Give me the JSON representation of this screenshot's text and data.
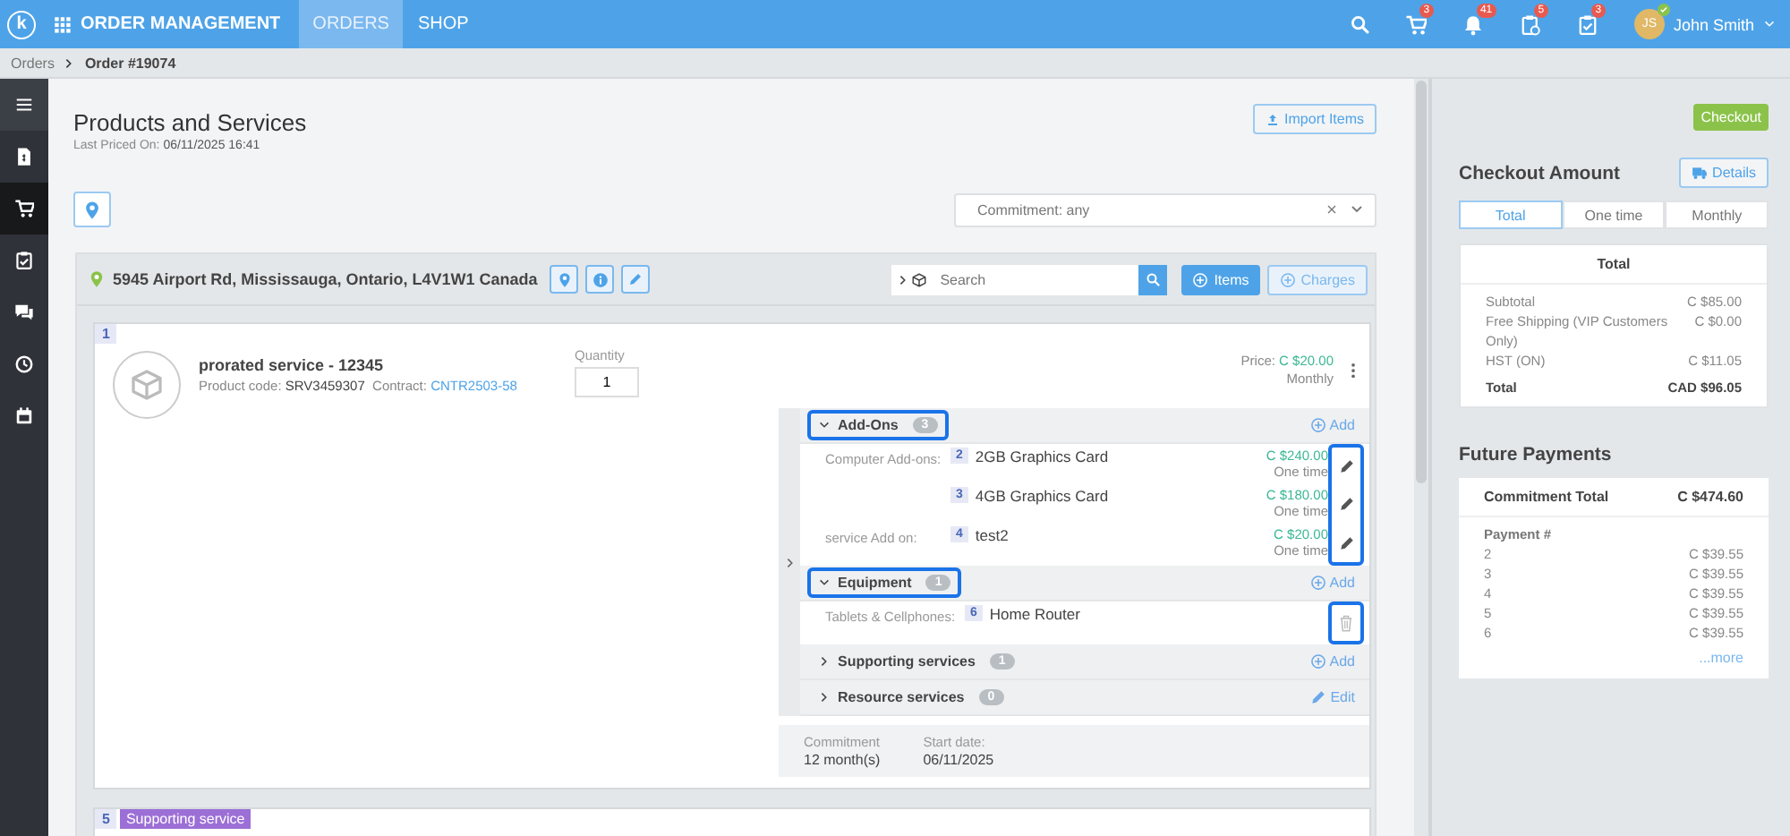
{
  "topbar": {
    "logo": "k",
    "app_title": "ORDER MANAGEMENT",
    "nav": [
      {
        "label": "ORDERS",
        "selected": true
      },
      {
        "label": "SHOP",
        "selected": false
      }
    ],
    "badges": [
      {
        "kind": "cart",
        "count": "3"
      },
      {
        "kind": "bell",
        "count": "41"
      },
      {
        "kind": "clipboard-clock",
        "count": "5"
      },
      {
        "kind": "clipboard-check",
        "count": "3"
      }
    ],
    "user": {
      "initials": "JS",
      "name": "John Smith",
      "online": true
    }
  },
  "breadcrumb": [
    "Orders",
    "Order #19074"
  ],
  "sidebar": {
    "items": [
      {
        "kind": "menu",
        "selected": false
      },
      {
        "kind": "invoice",
        "selected": false
      },
      {
        "kind": "cart",
        "selected": true
      },
      {
        "kind": "clipboard",
        "selected": false
      },
      {
        "kind": "chat",
        "selected": false
      },
      {
        "kind": "clock",
        "selected": false
      },
      {
        "kind": "calendar",
        "selected": false
      }
    ]
  },
  "page": {
    "title": "Products and Services",
    "last_priced_label": "Last Priced On:",
    "last_priced": "06/11/2025 16:41",
    "import_button": "Import Items",
    "commitment_filter": "Commitment: any"
  },
  "location": {
    "address": "5945 Airport Rd, Mississauga, Ontario, L4V1W1 Canada",
    "search_placeholder": "Search",
    "items_button": "Items",
    "charges_button": "Charges"
  },
  "line_item": {
    "number": "1",
    "name": "prorated service - 12345",
    "code_label": "Product code:",
    "code": "SRV3459307",
    "contract_label": "Contract:",
    "contract": "CNTR2503-58",
    "quantity_label": "Quantity",
    "quantity": "1",
    "price_label": "Price:",
    "price": "C $20.00",
    "period": "Monthly",
    "sections": [
      {
        "title": "Add-Ons",
        "count": "3",
        "expanded": true,
        "highlighted": true,
        "actions_highlighted": true,
        "action": {
          "kind": "add",
          "label": "Add"
        },
        "rows": [
          {
            "category": "Computer Add-ons:",
            "number": "2",
            "name": "2GB Graphics Card",
            "price": "C $240.00",
            "period": "One time",
            "kind": "edit"
          },
          {
            "number": "3",
            "name": "4GB Graphics Card",
            "price": "C $180.00",
            "period": "One time",
            "kind": "edit"
          },
          {
            "category": "service Add on:",
            "number": "4",
            "name": "test2",
            "price": "C $20.00",
            "period": "One time",
            "kind": "edit"
          }
        ]
      },
      {
        "title": "Equipment",
        "count": "1",
        "expanded": true,
        "highlighted": true,
        "actions_highlighted": true,
        "action": {
          "kind": "add",
          "label": "Add"
        },
        "rows": [
          {
            "category": "Tablets & Cellphones:",
            "number": "6",
            "name": "Home Router",
            "kind": "delete"
          }
        ]
      },
      {
        "title": "Supporting services",
        "count": "1",
        "expanded": false,
        "highlighted": false,
        "action": {
          "kind": "add",
          "label": "Add"
        }
      },
      {
        "title": "Resource services",
        "count": "0",
        "expanded": false,
        "highlighted": false,
        "action": {
          "kind": "edit",
          "label": "Edit"
        }
      }
    ],
    "commitment_label": "Commitment",
    "commitment": "12 month(s)",
    "start_label": "Start date:",
    "start": "06/11/2025"
  },
  "next_item": {
    "number": "5",
    "tag": "Supporting service"
  },
  "checkout": {
    "button": "Checkout",
    "title": "Checkout Amount",
    "details_button": "Details",
    "tabs": [
      {
        "label": "Total",
        "selected": true
      },
      {
        "label": "One time",
        "selected": false
      },
      {
        "label": "Monthly",
        "selected": false
      }
    ],
    "summary_title": "Total",
    "lines": [
      {
        "label": "Subtotal",
        "value": "C $85.00"
      },
      {
        "label": "Free Shipping (VIP Customers Only)",
        "value": "C $0.00"
      },
      {
        "label": "HST (ON)",
        "value": "C $11.05"
      }
    ],
    "total": {
      "label": "Total",
      "value": "CAD $96.05"
    }
  },
  "future_payments": {
    "title": "Future Payments",
    "total_label": "Commitment Total",
    "total": "C $474.60",
    "column": "Payment #",
    "payments": [
      {
        "number": "2",
        "amount": "C $39.55"
      },
      {
        "number": "3",
        "amount": "C $39.55"
      },
      {
        "number": "4",
        "amount": "C $39.55"
      },
      {
        "number": "5",
        "amount": "C $39.55"
      },
      {
        "number": "6",
        "amount": "C $39.55"
      }
    ],
    "more": "...more"
  }
}
